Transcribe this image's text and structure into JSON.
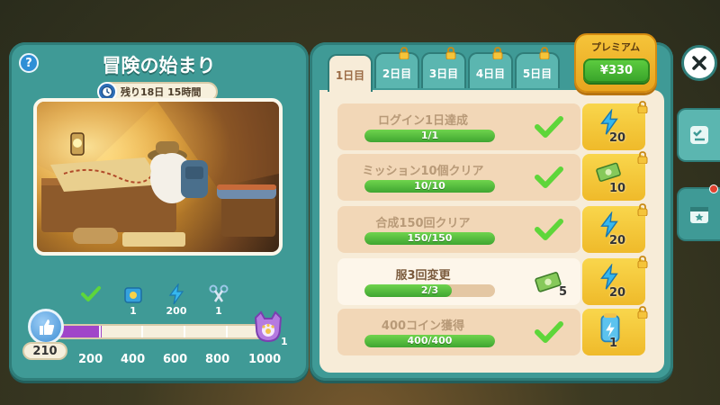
{
  "event": {
    "title": "冒険の始まり",
    "timer": "残り18日 15時間",
    "help_icon": "?"
  },
  "track": {
    "points": "210",
    "progress_fraction": 0.21,
    "milestones": [
      "200",
      "400",
      "600",
      "800",
      "1000"
    ],
    "final_reward_count": "1",
    "rewards": [
      {
        "icon": "checkmark-icon",
        "label": ""
      },
      {
        "icon": "gem-box-icon",
        "label": "1"
      },
      {
        "icon": "energy-bolt-icon",
        "label": "200"
      },
      {
        "icon": "scissors-icon",
        "label": "1"
      }
    ]
  },
  "tabs": [
    {
      "label": "1日目",
      "active": true,
      "locked": false
    },
    {
      "label": "2日目",
      "active": false,
      "locked": true
    },
    {
      "label": "3日目",
      "active": false,
      "locked": true
    },
    {
      "label": "4日目",
      "active": false,
      "locked": true
    },
    {
      "label": "5日目",
      "active": false,
      "locked": true
    }
  ],
  "premium": {
    "label": "プレミアム",
    "price": "¥330"
  },
  "missions": [
    {
      "title": "ログイン1日達成",
      "progress": "1/1",
      "fraction": 1.0,
      "done": true,
      "free_reward": null,
      "premium_reward": {
        "icon": "energy-bolt-icon",
        "amount": "20"
      }
    },
    {
      "title": "ミッション10個クリア",
      "progress": "10/10",
      "fraction": 1.0,
      "done": true,
      "free_reward": null,
      "premium_reward": {
        "icon": "cash-icon",
        "amount": "10"
      }
    },
    {
      "title": "合成150回クリア",
      "progress": "150/150",
      "fraction": 1.0,
      "done": true,
      "free_reward": null,
      "premium_reward": {
        "icon": "energy-bolt-icon",
        "amount": "20"
      }
    },
    {
      "title": "服3回変更",
      "progress": "2/3",
      "fraction": 0.67,
      "done": false,
      "free_reward": {
        "icon": "cash-icon",
        "amount": "5"
      },
      "premium_reward": {
        "icon": "energy-bolt-icon",
        "amount": "20"
      }
    },
    {
      "title": "400コイン獲得",
      "progress": "400/400",
      "fraction": 1.0,
      "done": true,
      "free_reward": null,
      "premium_reward": {
        "icon": "energy-can-icon",
        "amount": "1"
      }
    }
  ],
  "colors": {
    "panel": "#3f9a96",
    "progress_purple": "#a045c9",
    "bar_green": "#3fa531",
    "premium_gold": "#efba2a"
  }
}
